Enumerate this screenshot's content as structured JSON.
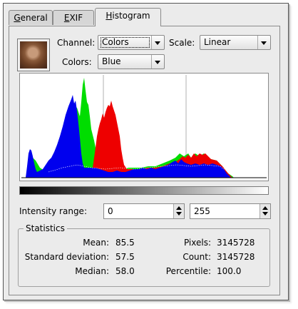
{
  "tabs": [
    {
      "pre": "",
      "u": "G",
      "post": "eneral"
    },
    {
      "pre": "",
      "u": "E",
      "post": "XIF"
    },
    {
      "pre": "",
      "u": "H",
      "post": "istogram"
    }
  ],
  "channel": {
    "label": "Channel:",
    "value": "Colors"
  },
  "scale": {
    "label": "Scale:",
    "value": "Linear"
  },
  "colors": {
    "label": "Colors:",
    "value": "Blue"
  },
  "intensity": {
    "label": "Intensity range:",
    "min": "0",
    "max": "255"
  },
  "statistics": {
    "title": "Statistics",
    "mean_label": "Mean:",
    "mean": "85.5",
    "std_label": "Standard deviation:",
    "std": "57.5",
    "median_label": "Median:",
    "median": "58.0",
    "pixels_label": "Pixels:",
    "pixels": "3145728",
    "count_label": "Count:",
    "count": "3145728",
    "percentile_label": "Percentile:",
    "percentile": "100.0"
  },
  "colors_map": {
    "blue": "#0000ee",
    "green": "#00dd00",
    "red": "#ee0000"
  }
}
